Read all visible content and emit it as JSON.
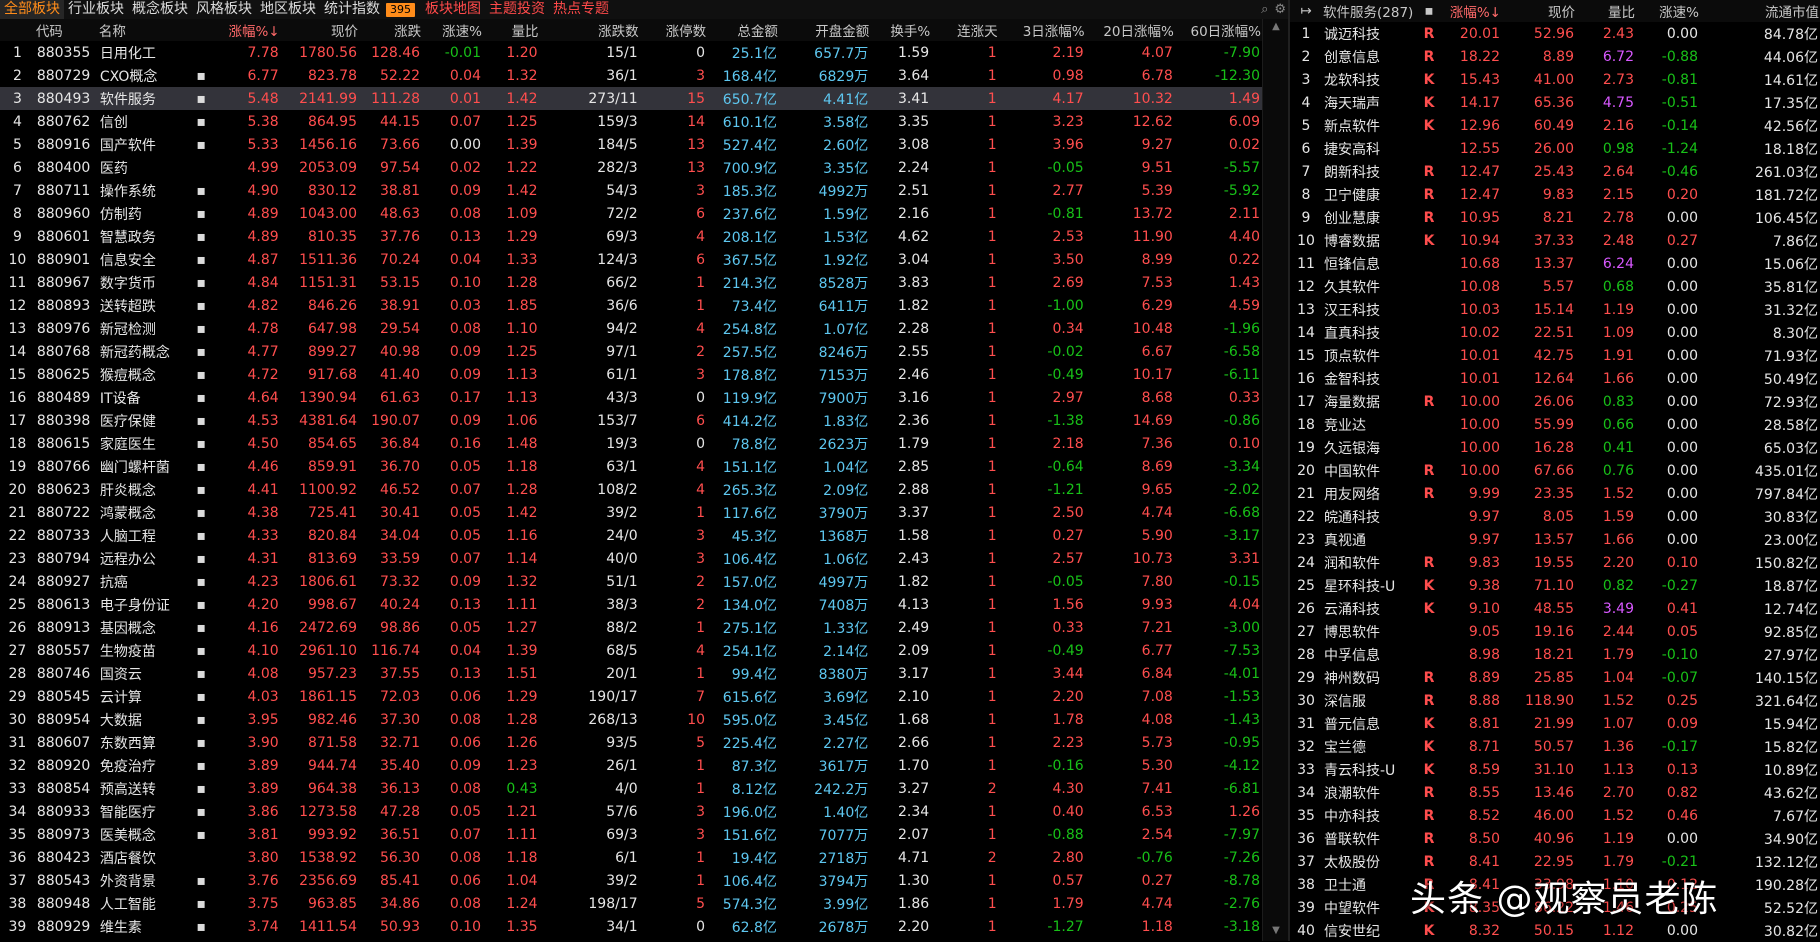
{
  "tabs": [
    {
      "label": "全部板块",
      "active": true
    },
    {
      "label": "行业板块"
    },
    {
      "label": "概念板块"
    },
    {
      "label": "风格板块"
    },
    {
      "label": "地区板块"
    },
    {
      "label": "统计指数",
      "badge": "395"
    },
    {
      "label": "板块地图",
      "red": true
    },
    {
      "label": "主题投资",
      "red": true
    },
    {
      "label": "热点专题",
      "red": true
    }
  ],
  "left_table": {
    "headers": [
      "",
      "代码",
      "名称",
      "",
      "涨幅%↓",
      "现价",
      "涨跌",
      "涨速%",
      "量比",
      "涨跌数",
      "涨停数",
      "总金额",
      "开盘金额",
      "换手%",
      "连涨天",
      "3日涨幅%",
      "20日涨幅%",
      "60日涨幅%"
    ],
    "rows": [
      [
        "1",
        "880355",
        "日用化工",
        "",
        "7.78",
        "1780.56",
        "128.46",
        "-0.01",
        "1.20",
        "15/1",
        "0",
        "25.1亿",
        "657.7万",
        "1.59",
        "1",
        "2.19",
        "4.07",
        "-7.90"
      ],
      [
        "2",
        "880729",
        "CXO概念",
        "▪",
        "6.77",
        "823.78",
        "52.22",
        "0.04",
        "1.32",
        "36/1",
        "3",
        "168.4亿",
        "6829万",
        "3.64",
        "1",
        "0.98",
        "6.78",
        "-12.30"
      ],
      [
        "3",
        "880493",
        "软件服务",
        "▪",
        "5.48",
        "2141.99",
        "111.28",
        "0.01",
        "1.42",
        "273/11",
        "15",
        "650.7亿",
        "4.41亿",
        "3.41",
        "1",
        "4.17",
        "10.32",
        "1.49"
      ],
      [
        "4",
        "880762",
        "信创",
        "▪",
        "5.38",
        "864.95",
        "44.15",
        "0.07",
        "1.25",
        "159/3",
        "14",
        "610.1亿",
        "3.58亿",
        "3.35",
        "1",
        "3.23",
        "12.62",
        "6.09"
      ],
      [
        "5",
        "880916",
        "国产软件",
        "▪",
        "5.33",
        "1456.16",
        "73.66",
        "0.00",
        "1.39",
        "184/5",
        "13",
        "527.4亿",
        "2.60亿",
        "3.08",
        "1",
        "3.96",
        "9.27",
        "0.02"
      ],
      [
        "6",
        "880400",
        "医药",
        "",
        "4.99",
        "2053.09",
        "97.54",
        "0.02",
        "1.22",
        "282/3",
        "13",
        "700.9亿",
        "3.35亿",
        "2.24",
        "1",
        "-0.05",
        "9.51",
        "-5.57"
      ],
      [
        "7",
        "880711",
        "操作系统",
        "▪",
        "4.90",
        "830.12",
        "38.81",
        "0.09",
        "1.42",
        "54/3",
        "3",
        "185.3亿",
        "4992万",
        "2.51",
        "1",
        "2.77",
        "5.39",
        "-5.92"
      ],
      [
        "8",
        "880960",
        "仿制药",
        "▪",
        "4.89",
        "1043.00",
        "48.63",
        "0.08",
        "1.09",
        "72/2",
        "6",
        "237.6亿",
        "1.59亿",
        "2.16",
        "1",
        "-0.81",
        "13.72",
        "2.11"
      ],
      [
        "9",
        "880601",
        "智慧政务",
        "▪",
        "4.89",
        "810.35",
        "37.76",
        "0.13",
        "1.29",
        "69/3",
        "4",
        "208.1亿",
        "1.53亿",
        "4.62",
        "1",
        "2.53",
        "11.90",
        "4.40"
      ],
      [
        "10",
        "880901",
        "信息安全",
        "▪",
        "4.87",
        "1511.36",
        "70.24",
        "0.04",
        "1.33",
        "124/3",
        "6",
        "367.5亿",
        "1.92亿",
        "3.04",
        "1",
        "3.50",
        "8.99",
        "0.22"
      ],
      [
        "11",
        "880967",
        "数字货币",
        "▪",
        "4.84",
        "1151.31",
        "53.15",
        "0.10",
        "1.28",
        "66/2",
        "1",
        "214.3亿",
        "8528万",
        "3.83",
        "1",
        "2.69",
        "7.53",
        "1.43"
      ],
      [
        "12",
        "880893",
        "送转超跌",
        "▪",
        "4.82",
        "846.26",
        "38.91",
        "0.03",
        "1.85",
        "36/6",
        "1",
        "73.4亿",
        "6411万",
        "1.82",
        "1",
        "-1.00",
        "6.29",
        "4.59"
      ],
      [
        "13",
        "880976",
        "新冠检测",
        "▪",
        "4.78",
        "647.98",
        "29.54",
        "0.08",
        "1.10",
        "94/2",
        "4",
        "254.8亿",
        "1.07亿",
        "2.28",
        "1",
        "0.34",
        "10.48",
        "-1.96"
      ],
      [
        "14",
        "880768",
        "新冠药概念",
        "▪",
        "4.77",
        "899.27",
        "40.98",
        "0.09",
        "1.25",
        "97/1",
        "2",
        "257.5亿",
        "8246万",
        "2.55",
        "1",
        "-0.02",
        "6.67",
        "-6.58"
      ],
      [
        "15",
        "880625",
        "猴痘概念",
        "▪",
        "4.72",
        "917.68",
        "41.40",
        "0.09",
        "1.13",
        "61/1",
        "3",
        "178.8亿",
        "7153万",
        "2.46",
        "1",
        "-0.49",
        "10.17",
        "-6.11"
      ],
      [
        "16",
        "880489",
        "IT设备",
        "▪",
        "4.64",
        "1390.94",
        "61.63",
        "0.17",
        "1.13",
        "43/3",
        "0",
        "119.9亿",
        "7900万",
        "3.16",
        "1",
        "2.97",
        "8.68",
        "0.33"
      ],
      [
        "17",
        "880398",
        "医疗保健",
        "▪",
        "4.53",
        "4381.64",
        "190.07",
        "0.09",
        "1.06",
        "153/7",
        "6",
        "414.2亿",
        "1.83亿",
        "2.36",
        "1",
        "-1.38",
        "14.69",
        "-0.86"
      ],
      [
        "18",
        "880615",
        "家庭医生",
        "▪",
        "4.50",
        "854.65",
        "36.84",
        "0.16",
        "1.48",
        "19/3",
        "0",
        "78.8亿",
        "2623万",
        "1.79",
        "1",
        "2.18",
        "7.36",
        "0.10"
      ],
      [
        "19",
        "880766",
        "幽门螺杆菌",
        "▪",
        "4.46",
        "859.91",
        "36.70",
        "0.05",
        "1.18",
        "63/1",
        "4",
        "151.1亿",
        "1.04亿",
        "2.85",
        "1",
        "-0.64",
        "8.69",
        "-3.34"
      ],
      [
        "20",
        "880623",
        "肝炎概念",
        "▪",
        "4.41",
        "1100.92",
        "46.52",
        "0.07",
        "1.28",
        "108/2",
        "4",
        "265.3亿",
        "2.09亿",
        "2.88",
        "1",
        "-1.21",
        "9.65",
        "-2.02"
      ],
      [
        "21",
        "880722",
        "鸿蒙概念",
        "▪",
        "4.38",
        "725.41",
        "30.41",
        "0.05",
        "1.42",
        "39/2",
        "1",
        "117.6亿",
        "3790万",
        "3.37",
        "1",
        "2.50",
        "4.74",
        "-6.68"
      ],
      [
        "22",
        "880733",
        "人脑工程",
        "▪",
        "4.33",
        "820.84",
        "34.04",
        "0.05",
        "1.16",
        "24/0",
        "3",
        "45.3亿",
        "1368万",
        "1.58",
        "1",
        "0.27",
        "5.90",
        "-3.17"
      ],
      [
        "23",
        "880794",
        "远程办公",
        "▪",
        "4.31",
        "813.69",
        "33.59",
        "0.07",
        "1.14",
        "40/0",
        "3",
        "106.4亿",
        "1.06亿",
        "2.43",
        "1",
        "2.57",
        "10.73",
        "3.31"
      ],
      [
        "24",
        "880927",
        "抗癌",
        "▪",
        "4.23",
        "1806.61",
        "73.32",
        "0.09",
        "1.32",
        "51/1",
        "2",
        "157.0亿",
        "4997万",
        "1.82",
        "1",
        "-0.05",
        "7.80",
        "-0.15"
      ],
      [
        "25",
        "880613",
        "电子身份证",
        "▪",
        "4.20",
        "998.67",
        "40.24",
        "0.13",
        "1.11",
        "38/3",
        "2",
        "134.0亿",
        "7408万",
        "4.13",
        "1",
        "1.56",
        "9.93",
        "4.04"
      ],
      [
        "26",
        "880913",
        "基因概念",
        "▪",
        "4.16",
        "2472.69",
        "98.86",
        "0.05",
        "1.27",
        "88/2",
        "1",
        "275.1亿",
        "1.33亿",
        "2.49",
        "1",
        "0.33",
        "7.21",
        "-3.00"
      ],
      [
        "27",
        "880557",
        "生物疫苗",
        "▪",
        "4.10",
        "2961.10",
        "116.74",
        "0.04",
        "1.39",
        "68/5",
        "4",
        "254.1亿",
        "2.14亿",
        "2.09",
        "1",
        "-0.49",
        "6.77",
        "-7.53"
      ],
      [
        "28",
        "880746",
        "国资云",
        "▪",
        "4.08",
        "957.23",
        "37.55",
        "0.13",
        "1.51",
        "20/1",
        "1",
        "99.4亿",
        "8380万",
        "3.17",
        "1",
        "3.44",
        "6.84",
        "-4.01"
      ],
      [
        "29",
        "880545",
        "云计算",
        "▪",
        "4.03",
        "1861.15",
        "72.03",
        "0.06",
        "1.29",
        "190/17",
        "7",
        "615.6亿",
        "3.69亿",
        "2.10",
        "1",
        "2.20",
        "7.08",
        "-1.53"
      ],
      [
        "30",
        "880954",
        "大数据",
        "▪",
        "3.95",
        "982.46",
        "37.30",
        "0.08",
        "1.28",
        "268/13",
        "10",
        "595.0亿",
        "3.45亿",
        "1.68",
        "1",
        "1.78",
        "4.08",
        "-1.43"
      ],
      [
        "31",
        "880607",
        "东数西算",
        "▪",
        "3.90",
        "871.58",
        "32.71",
        "0.06",
        "1.26",
        "93/5",
        "5",
        "225.4亿",
        "2.27亿",
        "2.66",
        "1",
        "2.23",
        "5.73",
        "-0.95"
      ],
      [
        "32",
        "880920",
        "免疫治疗",
        "▪",
        "3.89",
        "944.74",
        "35.40",
        "0.09",
        "1.23",
        "26/1",
        "1",
        "87.3亿",
        "3617万",
        "1.70",
        "1",
        "-0.16",
        "5.30",
        "-4.12"
      ],
      [
        "33",
        "880854",
        "预高送转",
        "▪",
        "3.89",
        "964.38",
        "36.13",
        "0.08",
        "0.43",
        "4/0",
        "1",
        "8.12亿",
        "242.2万",
        "3.27",
        "2",
        "4.30",
        "7.41",
        "-6.81"
      ],
      [
        "34",
        "880933",
        "智能医疗",
        "▪",
        "3.86",
        "1273.58",
        "47.28",
        "0.05",
        "1.21",
        "57/6",
        "3",
        "196.0亿",
        "1.40亿",
        "2.34",
        "1",
        "0.40",
        "6.53",
        "1.26"
      ],
      [
        "35",
        "880973",
        "医美概念",
        "▪",
        "3.81",
        "993.92",
        "36.51",
        "0.07",
        "1.11",
        "69/3",
        "3",
        "151.6亿",
        "7077万",
        "2.07",
        "1",
        "-0.88",
        "2.54",
        "-7.97"
      ],
      [
        "36",
        "880423",
        "酒店餐饮",
        "",
        "3.80",
        "1538.92",
        "56.30",
        "0.08",
        "1.18",
        "6/1",
        "1",
        "19.4亿",
        "2718万",
        "4.71",
        "2",
        "2.80",
        "-0.76",
        "-7.26"
      ],
      [
        "37",
        "880543",
        "外资背景",
        "▪",
        "3.76",
        "2356.69",
        "85.41",
        "0.06",
        "1.04",
        "39/2",
        "1",
        "106.4亿",
        "3794万",
        "1.30",
        "1",
        "0.57",
        "0.27",
        "-8.78"
      ],
      [
        "38",
        "880948",
        "人工智能",
        "▪",
        "3.75",
        "963.85",
        "34.86",
        "0.08",
        "1.24",
        "198/17",
        "5",
        "574.3亿",
        "3.99亿",
        "1.86",
        "1",
        "1.79",
        "4.74",
        "-2.76"
      ],
      [
        "39",
        "880929",
        "维生素",
        "▪",
        "3.74",
        "1411.54",
        "50.93",
        "0.10",
        "1.35",
        "34/1",
        "0",
        "62.8亿",
        "2678万",
        "2.20",
        "1",
        "-1.27",
        "1.18",
        "-3.18"
      ]
    ]
  },
  "right_table": {
    "headers": [
      "↦",
      "软件服务(287)",
      "▪",
      "涨幅%↓",
      "现价",
      "量比",
      "涨速%",
      "流通市值"
    ],
    "rows": [
      [
        "1",
        "诚迈科技",
        "R",
        "20.01",
        "52.96",
        "2.43",
        "0.00",
        "84.78亿"
      ],
      [
        "2",
        "创意信息",
        "R",
        "18.22",
        "8.89",
        "6.72",
        "-0.88",
        "44.06亿"
      ],
      [
        "3",
        "龙软科技",
        "K",
        "15.43",
        "41.00",
        "2.73",
        "-0.81",
        "14.61亿"
      ],
      [
        "4",
        "海天瑞声",
        "K",
        "14.17",
        "65.36",
        "4.75",
        "-0.51",
        "17.35亿"
      ],
      [
        "5",
        "新点软件",
        "K",
        "12.96",
        "60.49",
        "2.16",
        "-0.14",
        "42.56亿"
      ],
      [
        "6",
        "捷安高科",
        "",
        "12.55",
        "26.00",
        "0.98",
        "-1.24",
        "18.18亿"
      ],
      [
        "7",
        "朗新科技",
        "R",
        "12.47",
        "25.43",
        "2.64",
        "-0.46",
        "261.03亿"
      ],
      [
        "8",
        "卫宁健康",
        "R",
        "12.47",
        "9.83",
        "2.15",
        "0.20",
        "181.72亿"
      ],
      [
        "9",
        "创业慧康",
        "R",
        "10.95",
        "8.21",
        "2.78",
        "0.00",
        "106.45亿"
      ],
      [
        "10",
        "博睿数据",
        "K",
        "10.94",
        "37.33",
        "2.48",
        "0.27",
        "7.86亿"
      ],
      [
        "11",
        "恒锋信息",
        "",
        "10.68",
        "13.37",
        "6.24",
        "0.00",
        "15.06亿"
      ],
      [
        "12",
        "久其软件",
        "",
        "10.08",
        "5.57",
        "0.68",
        "0.00",
        "35.81亿"
      ],
      [
        "13",
        "汉王科技",
        "",
        "10.03",
        "15.14",
        "1.19",
        "0.00",
        "31.32亿"
      ],
      [
        "14",
        "直真科技",
        "",
        "10.02",
        "22.51",
        "1.09",
        "0.00",
        "8.30亿"
      ],
      [
        "15",
        "顶点软件",
        "",
        "10.01",
        "42.75",
        "1.91",
        "0.00",
        "71.93亿"
      ],
      [
        "16",
        "金智科技",
        "",
        "10.01",
        "12.64",
        "1.66",
        "0.00",
        "50.49亿"
      ],
      [
        "17",
        "海量数据",
        "R",
        "10.00",
        "26.06",
        "0.83",
        "0.00",
        "72.93亿"
      ],
      [
        "18",
        "竞业达",
        "",
        "10.00",
        "55.99",
        "0.66",
        "0.00",
        "28.58亿"
      ],
      [
        "19",
        "久远银海",
        "",
        "10.00",
        "16.28",
        "0.41",
        "0.00",
        "65.03亿"
      ],
      [
        "20",
        "中国软件",
        "R",
        "10.00",
        "67.66",
        "0.76",
        "0.00",
        "435.01亿"
      ],
      [
        "21",
        "用友网络",
        "R",
        "9.99",
        "23.35",
        "1.52",
        "0.00",
        "797.84亿"
      ],
      [
        "22",
        "皖通科技",
        "",
        "9.97",
        "8.05",
        "1.59",
        "0.00",
        "30.83亿"
      ],
      [
        "23",
        "真视通",
        "",
        "9.97",
        "13.57",
        "1.66",
        "0.00",
        "23.00亿"
      ],
      [
        "24",
        "润和软件",
        "R",
        "9.83",
        "19.55",
        "2.20",
        "0.10",
        "150.82亿"
      ],
      [
        "25",
        "星环科技-U",
        "K",
        "9.38",
        "71.10",
        "0.82",
        "-0.27",
        "18.87亿"
      ],
      [
        "26",
        "云涌科技",
        "K",
        "9.10",
        "48.55",
        "3.49",
        "0.41",
        "12.74亿"
      ],
      [
        "27",
        "博思软件",
        "",
        "9.05",
        "19.16",
        "2.44",
        "0.05",
        "92.85亿"
      ],
      [
        "28",
        "中孚信息",
        "",
        "8.98",
        "18.21",
        "1.79",
        "-0.10",
        "27.97亿"
      ],
      [
        "29",
        "神州数码",
        "R",
        "8.89",
        "25.85",
        "1.04",
        "-0.07",
        "140.15亿"
      ],
      [
        "30",
        "深信服",
        "R",
        "8.88",
        "118.90",
        "1.52",
        "0.25",
        "321.64亿"
      ],
      [
        "31",
        "普元信息",
        "K",
        "8.81",
        "21.99",
        "1.07",
        "0.09",
        "15.94亿"
      ],
      [
        "32",
        "宝兰德",
        "K",
        "8.71",
        "50.57",
        "1.36",
        "-0.17",
        "15.82亿"
      ],
      [
        "33",
        "青云科技-U",
        "K",
        "8.59",
        "31.10",
        "1.13",
        "0.13",
        "10.89亿"
      ],
      [
        "34",
        "浪潮软件",
        "R",
        "8.55",
        "13.46",
        "2.70",
        "0.82",
        "43.62亿"
      ],
      [
        "35",
        "中亦科技",
        "R",
        "8.52",
        "46.00",
        "1.52",
        "0.46",
        "7.67亿"
      ],
      [
        "36",
        "普联软件",
        "R",
        "8.50",
        "40.96",
        "1.19",
        "0.00",
        "34.90亿"
      ],
      [
        "37",
        "太极股份",
        "R",
        "8.41",
        "22.95",
        "1.79",
        "-0.21",
        "132.12亿"
      ],
      [
        "38",
        "卫士通",
        "R",
        "8.41",
        "33.98",
        "1.10",
        "0.12",
        "190.28亿"
      ],
      [
        "39",
        "中望软件",
        "K",
        "8.35",
        "86.22",
        "1.46",
        "0.25",
        "52.52亿"
      ],
      [
        "40",
        "信安世纪",
        "K",
        "8.32",
        "50.15",
        "1.12",
        "0.00",
        "30.82亿"
      ]
    ]
  },
  "watermark": "头条 @观察员老陈"
}
